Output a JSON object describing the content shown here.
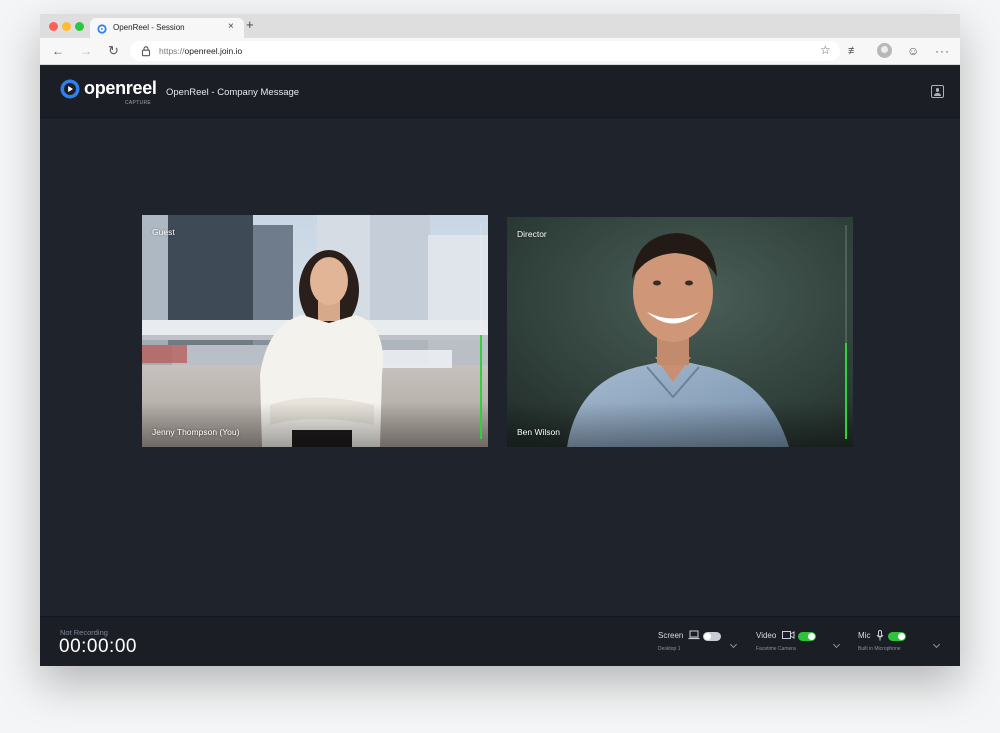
{
  "browser": {
    "tab_title": "OpenReel - Session",
    "tab_close": "×",
    "new_tab": "+",
    "url_prefix": "https://",
    "url_host": "openreel.join.io"
  },
  "app": {
    "logo_text": "openreel",
    "logo_sub": "CAPTURE",
    "session_title": "OpenReel - Company Message"
  },
  "participants": [
    {
      "role": "Guest",
      "name": "Jenny Thompson (You)",
      "audio_level": 0.48
    },
    {
      "role": "Director",
      "name": "Ben Wilson",
      "audio_level": 0.45
    }
  ],
  "recording": {
    "status": "Not Recording",
    "timer": "00:00:00"
  },
  "controls": {
    "screen": {
      "label": "Screen",
      "device": "Desktop 1",
      "enabled": false
    },
    "video": {
      "label": "Video",
      "device": "Facetime Camera",
      "enabled": true
    },
    "mic": {
      "label": "Mic",
      "device": "Built in Microphone",
      "enabled": true
    }
  },
  "colors": {
    "background": "#1f232b",
    "header": "#1b1e25",
    "accent_blue": "#2f80ed",
    "toggle_on": "#2ec13a",
    "level_meter": "#2fd13d"
  }
}
